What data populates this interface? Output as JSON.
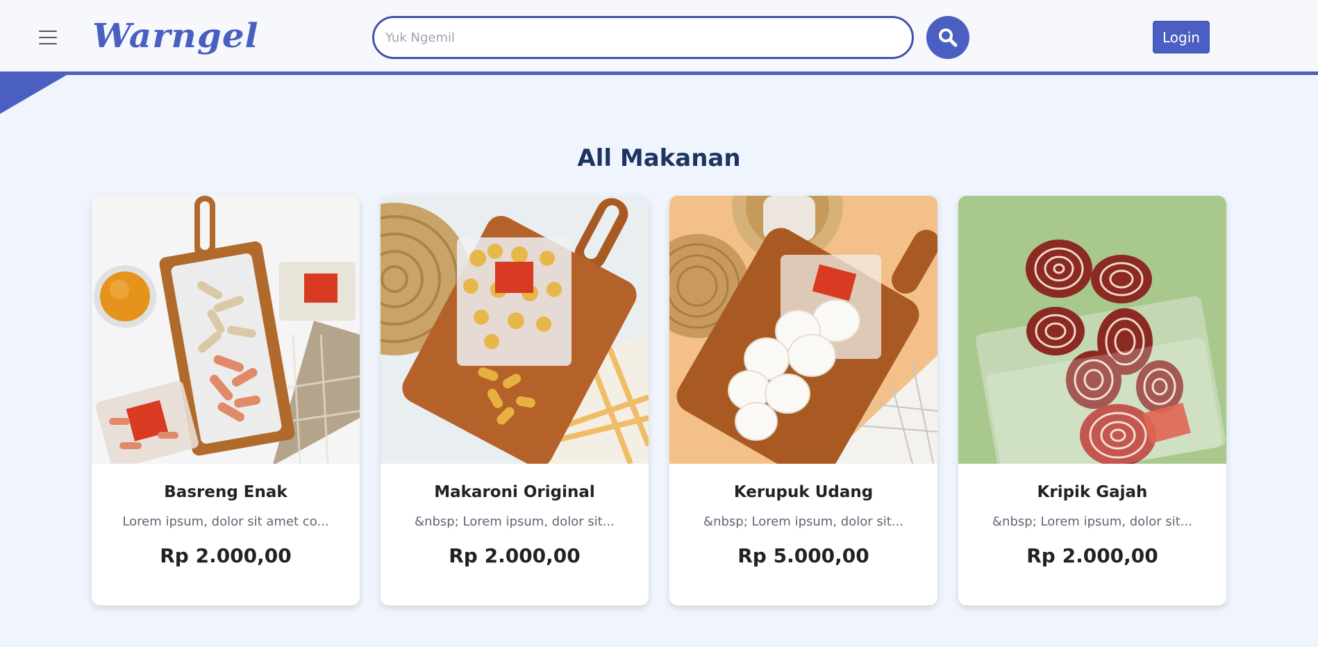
{
  "navbar": {
    "brand": "Warngel",
    "search_placeholder": "Yuk Ngemil",
    "login_label": "Login"
  },
  "icons": {
    "menu": "hamburger-icon",
    "search": "search-icon"
  },
  "colors": {
    "accent": "#4a5fc1",
    "background": "#f0f5fd",
    "title": "#1d3461"
  },
  "section": {
    "title": "All Makanan"
  },
  "products": [
    {
      "name": "Basreng Enak",
      "description": "Lorem ipsum, dolor sit amet co...",
      "price": "Rp 2.000,00"
    },
    {
      "name": "Makaroni Original",
      "description": "&nbsp; Lorem ipsum, dolor sit...",
      "price": "Rp 2.000,00"
    },
    {
      "name": "Kerupuk Udang",
      "description": "&nbsp; Lorem ipsum, dolor sit...",
      "price": "Rp 5.000,00"
    },
    {
      "name": "Kripik Gajah",
      "description": "&nbsp; Lorem ipsum, dolor sit...",
      "price": "Rp 2.000,00"
    }
  ]
}
